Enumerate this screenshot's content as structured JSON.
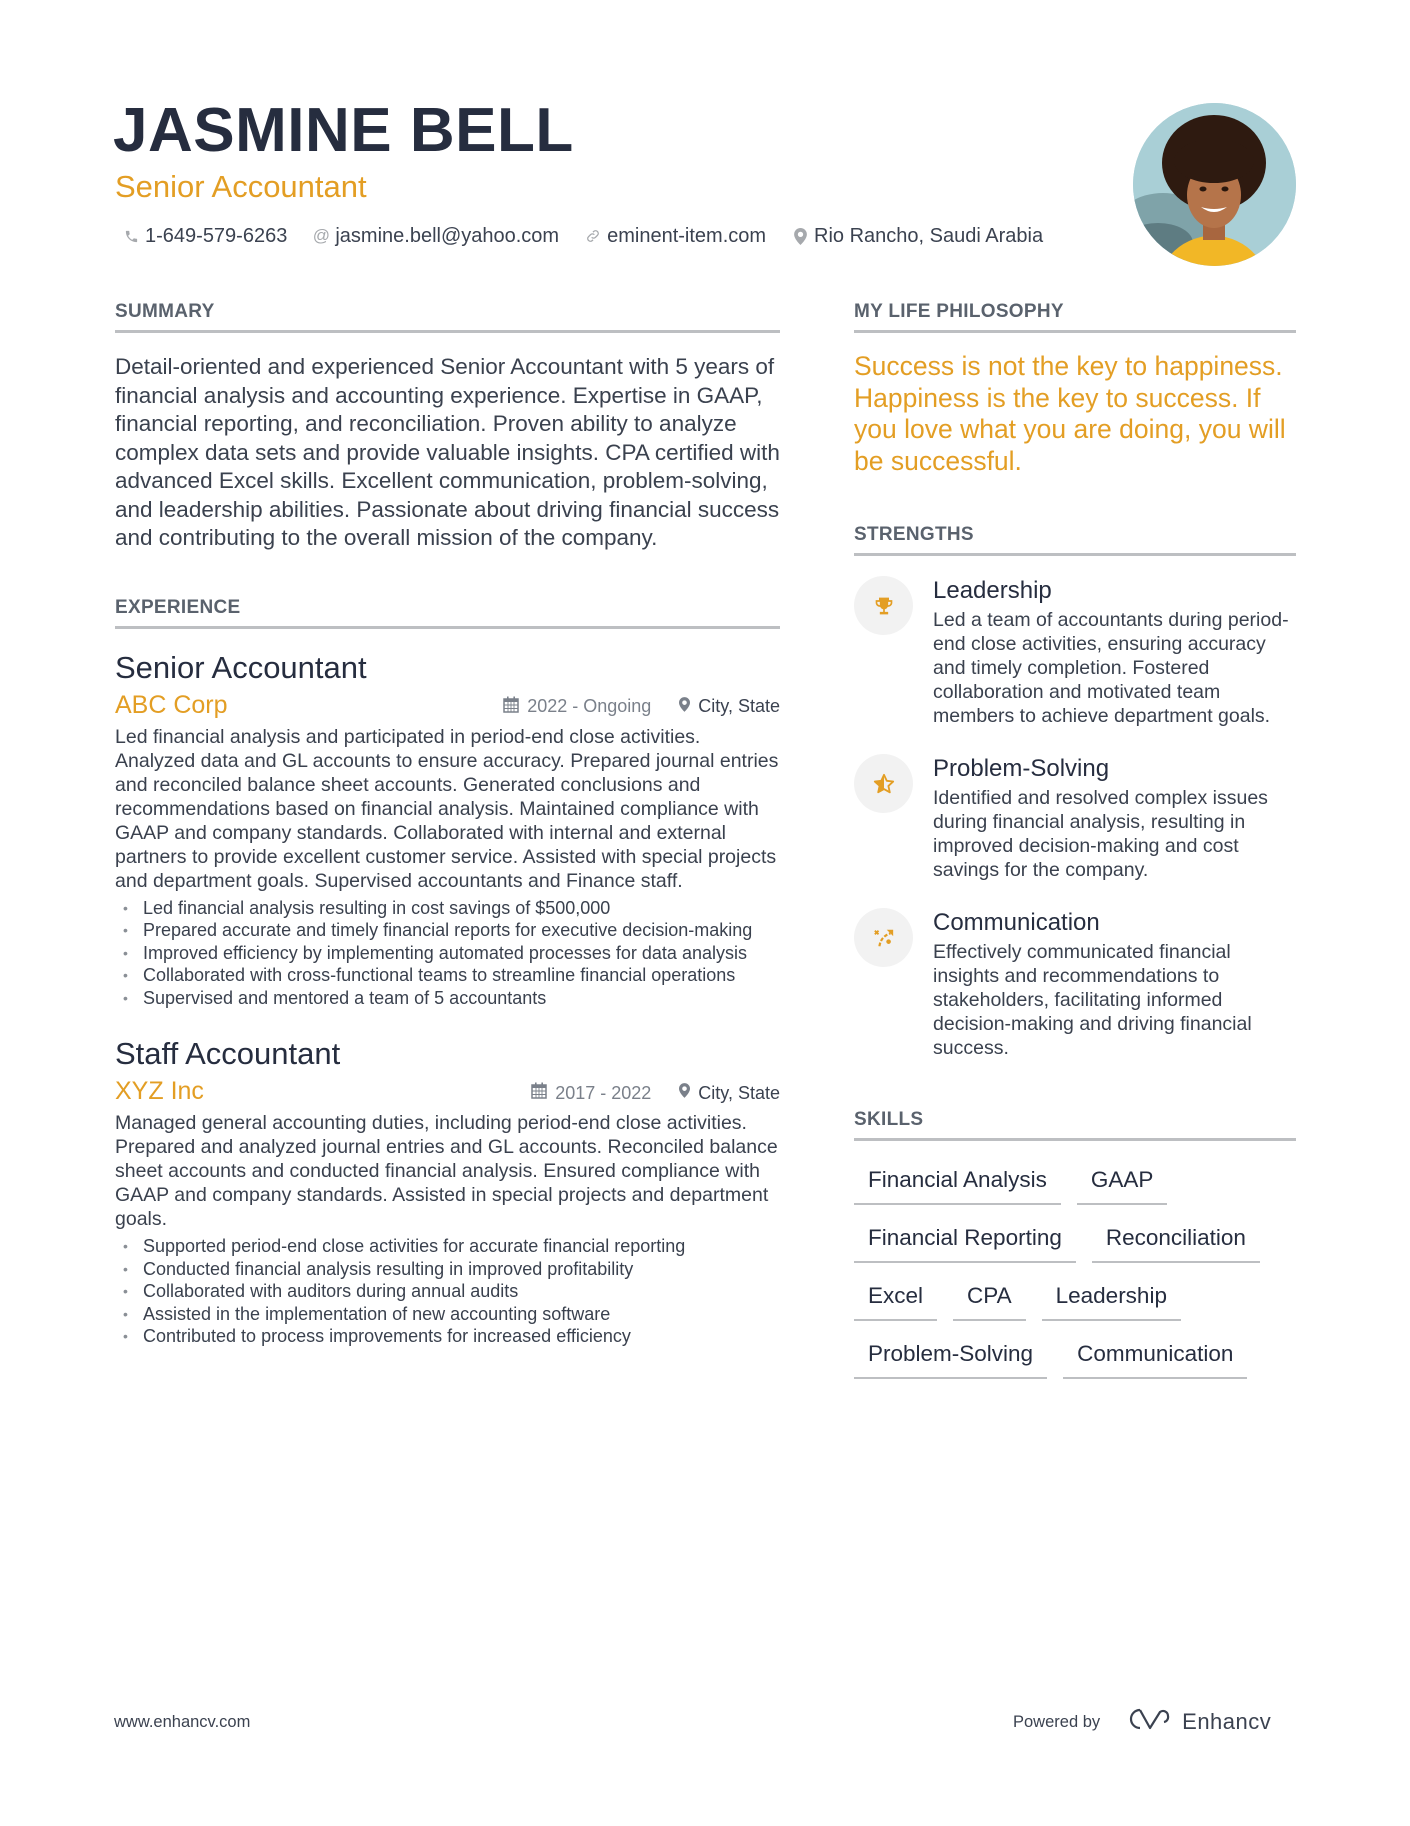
{
  "header": {
    "name": "JASMINE BELL",
    "headline": "Senior Accountant",
    "contacts": [
      {
        "icon": "phone-icon",
        "value": "1-649-579-6263"
      },
      {
        "icon": "at-icon",
        "value": "jasmine.bell@yahoo.com"
      },
      {
        "icon": "link-icon",
        "value": "eminent-item.com"
      },
      {
        "icon": "location-pin-icon",
        "value": "Rio Rancho, Saudi Arabia"
      }
    ],
    "photo_alt": "Profile photo"
  },
  "summary": {
    "title": "SUMMARY",
    "text": "Detail-oriented and experienced Senior Accountant with 5 years of financial analysis and accounting experience. Expertise in GAAP, financial reporting, and reconciliation. Proven ability to analyze complex data sets and provide valuable insights. CPA certified with advanced Excel skills. Excellent communication, problem-solving, and leadership abilities. Passionate about driving financial success and contributing to the overall mission of the company."
  },
  "experience": {
    "title": "EXPERIENCE",
    "jobs": [
      {
        "title": "Senior Accountant",
        "company": "ABC Corp",
        "dates": "2022 - Ongoing",
        "location": "City, State",
        "description": "Led financial analysis and participated in period-end close activities. Analyzed data and GL accounts to ensure accuracy. Prepared journal entries and reconciled balance sheet accounts. Generated conclusions and recommendations based on financial analysis. Maintained compliance with GAAP and company standards. Collaborated with internal and external partners to provide excellent customer service. Assisted with special projects and department goals. Supervised accountants and Finance staff.",
        "bullets": [
          "Led financial analysis resulting in cost savings of $500,000",
          "Prepared accurate and timely financial reports for executive decision-making",
          "Improved efficiency by implementing automated processes for data analysis",
          "Collaborated with cross-functional teams to streamline financial operations",
          "Supervised and mentored a team of 5 accountants"
        ]
      },
      {
        "title": "Staff Accountant",
        "company": "XYZ Inc",
        "dates": "2017 - 2022",
        "location": "City, State",
        "description": "Managed general accounting duties, including period-end close activities. Prepared and analyzed journal entries and GL accounts. Reconciled balance sheet accounts and conducted financial analysis. Ensured compliance with GAAP and company standards. Assisted in special projects and department goals.",
        "bullets": [
          "Supported period-end close activities for accurate financial reporting",
          "Conducted financial analysis resulting in improved profitability",
          "Collaborated with auditors during annual audits",
          "Assisted in the implementation of new accounting software",
          "Contributed to process improvements for increased efficiency"
        ]
      }
    ]
  },
  "philosophy": {
    "title": "MY LIFE PHILOSOPHY",
    "quote": "Success is not the key to happiness. Happiness is the key to success. If you love what you are doing, you will be successful."
  },
  "strengths": {
    "title": "STRENGTHS",
    "items": [
      {
        "icon": "trophy-icon",
        "title": "Leadership",
        "description": "Led a team of accountants during period-end close activities, ensuring accuracy and timely completion. Fostered collaboration and motivated team members to achieve department goals."
      },
      {
        "icon": "star-half-icon",
        "title": "Problem-Solving",
        "description": "Identified and resolved complex issues during financial analysis, resulting in improved decision-making and cost savings for the company."
      },
      {
        "icon": "strategy-arrow-icon",
        "title": "Communication",
        "description": "Effectively communicated financial insights and recommendations to stakeholders, facilitating informed decision-making and driving financial success."
      }
    ]
  },
  "skills": {
    "title": "SKILLS",
    "items": [
      "Financial Analysis",
      "GAAP",
      "Financial Reporting",
      "Reconciliation",
      "Excel",
      "CPA",
      "Leadership",
      "Problem-Solving",
      "Communication"
    ]
  },
  "footer": {
    "website": "www.enhancv.com",
    "powered_by": "Powered by",
    "brand": "Enhancv"
  },
  "colors": {
    "accent": "#e39e24",
    "heading": "#262d3f",
    "text": "#3a414e",
    "rule": "#bdbfc2"
  }
}
